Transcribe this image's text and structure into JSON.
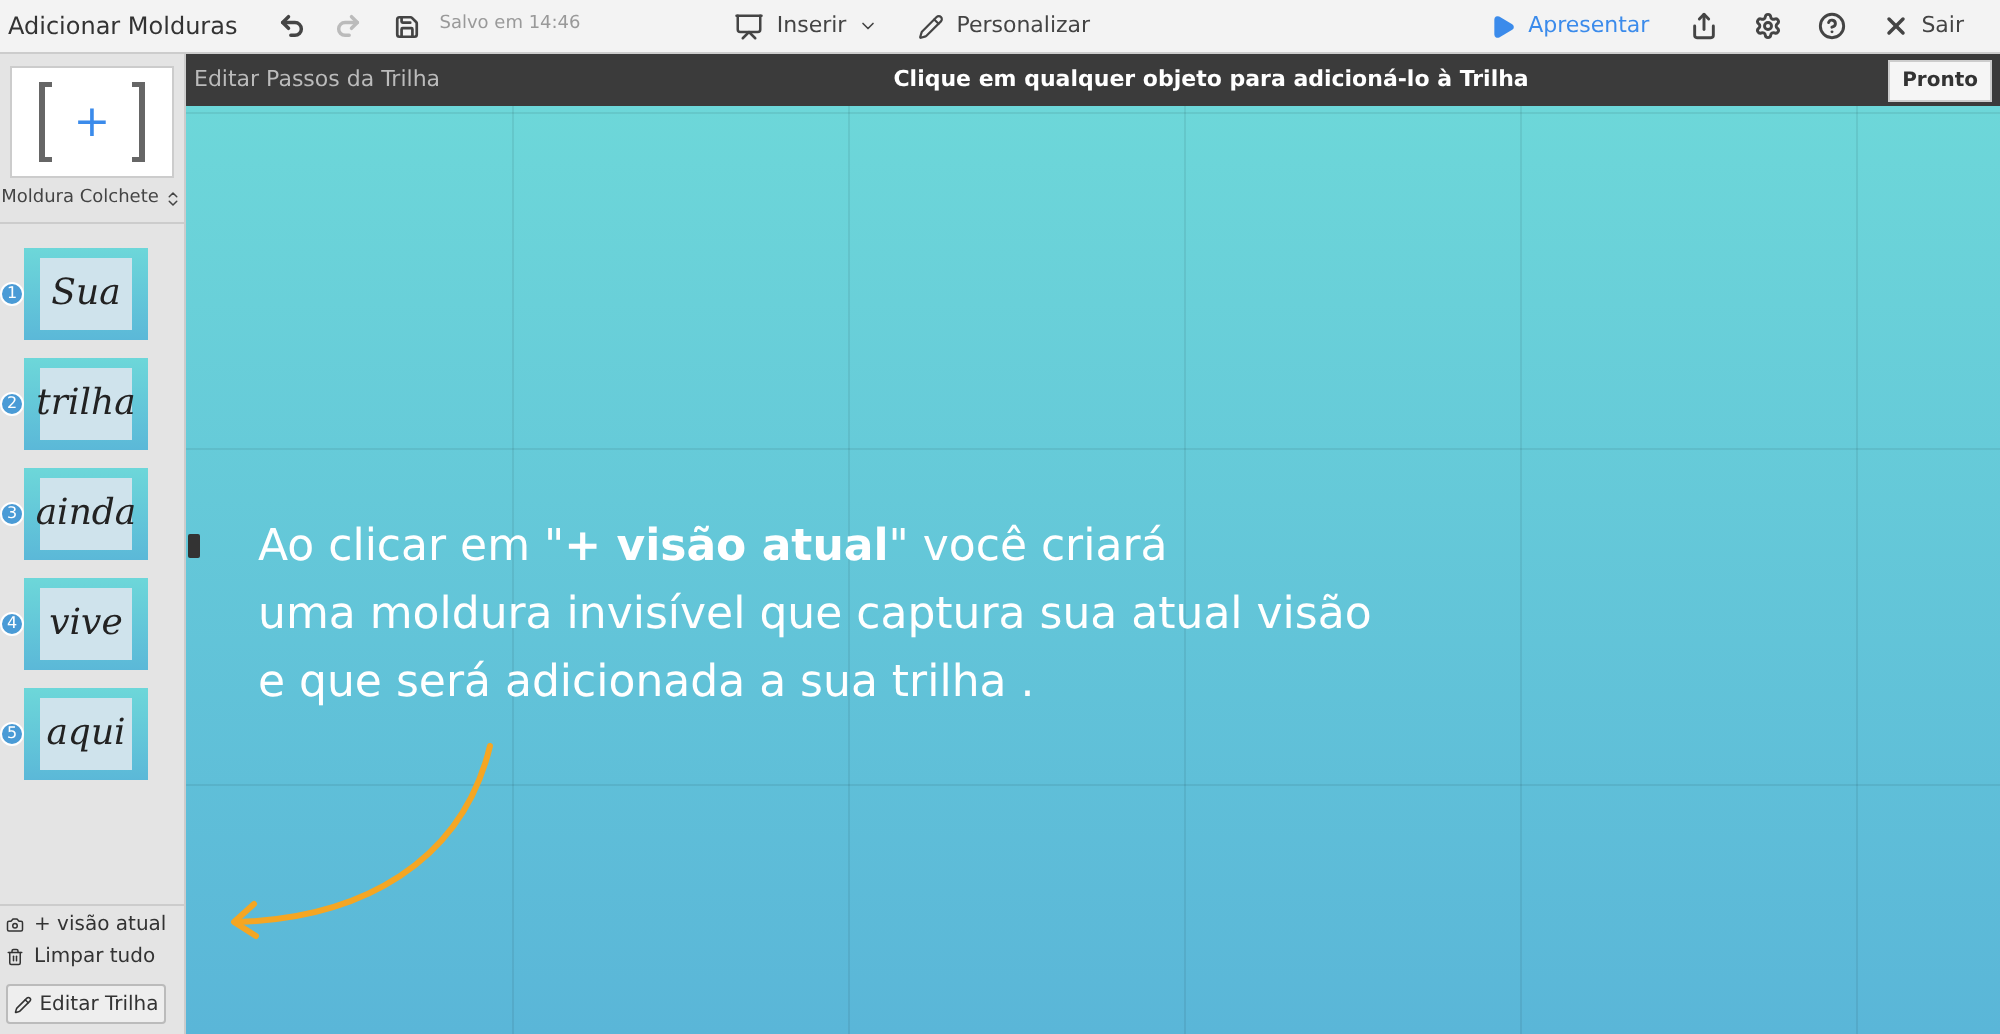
{
  "toolbar": {
    "title": "Adicionar Molduras",
    "saved": "Salvo em 14:46",
    "insert": "Inserir",
    "customize": "Personalizar",
    "present": "Apresentar",
    "exit": "Sair"
  },
  "edit_bar": {
    "title": "Editar Passos da Trilha",
    "hint": "Clique em qualquer objeto para adicioná-lo à Trilha",
    "done": "Pronto"
  },
  "sidebar": {
    "frame_label": "Moldura Colchete",
    "frame_symbol": "+",
    "steps": [
      {
        "number": "1",
        "word": "Sua"
      },
      {
        "number": "2",
        "word": "trilha"
      },
      {
        "number": "3",
        "word": "ainda"
      },
      {
        "number": "4",
        "word": "vive"
      },
      {
        "number": "5",
        "word": "aqui"
      }
    ],
    "add_view": "+ visão atual",
    "clear": "Limpar tudo",
    "edit_path": "Editar Trilha"
  },
  "canvas": {
    "message": [
      "Ao clicar em \"**+ visão atual**\" você criará",
      "uma moldura invisível que captura sua atual visão",
      "e que será adicionada a sua trilha ."
    ]
  }
}
